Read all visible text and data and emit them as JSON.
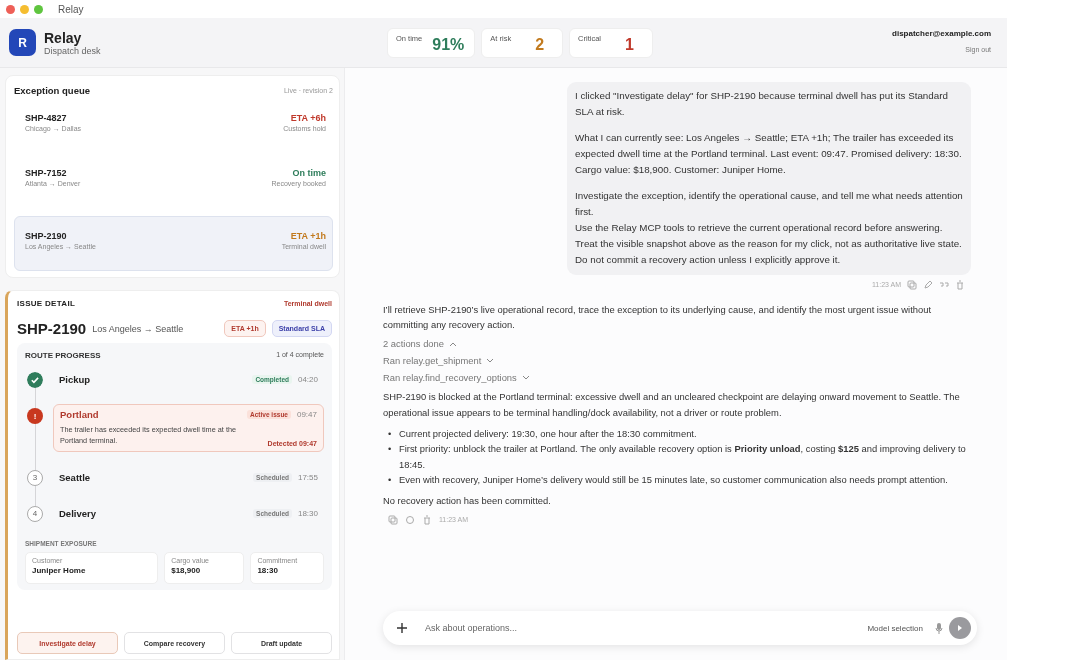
{
  "window": {
    "title": "Relay"
  },
  "app": {
    "logo": "R",
    "name": "Relay",
    "subtitle": "Dispatch desk"
  },
  "metrics": [
    {
      "label": "On time",
      "value": "91%",
      "color": "#2e7d5b"
    },
    {
      "label": "At risk",
      "value": "2",
      "color": "#c27a1e"
    },
    {
      "label": "Critical",
      "value": "1",
      "color": "#c0392b"
    }
  ],
  "account": {
    "email": "dispatcher@example.com",
    "sign_out": "Sign out"
  },
  "queue": {
    "title": "Exception queue",
    "status": "Live · revision 2",
    "items": [
      {
        "id": "SHP-4827",
        "route": "Chicago → Dallas",
        "eta": "ETA +6h",
        "note": "Customs hold",
        "color": "#c0392b",
        "selected": false
      },
      {
        "id": "SHP-7152",
        "route": "Atlanta → Denver",
        "eta": "On time",
        "note": "Recovery booked",
        "color": "#2e7d5b",
        "selected": false
      },
      {
        "id": "SHP-2190",
        "route": "Los Angeles → Seattle",
        "eta": "ETA +1h",
        "note": "Terminal dwell",
        "color": "#c27a1e",
        "selected": true
      }
    ]
  },
  "issue": {
    "heading": "ISSUE DETAIL",
    "tag": "Terminal dwell",
    "id": "SHP-2190",
    "route": "Los Angeles → Seattle",
    "badges": [
      {
        "label": "ETA +1h",
        "kind": "risk"
      },
      {
        "label": "Standard SLA",
        "kind": "sla"
      }
    ],
    "progress": {
      "title": "ROUTE PROGRESS",
      "summary": "1 of 4 complete",
      "stops": [
        {
          "kind": "done",
          "name": "Pickup",
          "status": "Completed",
          "time": "04:20"
        },
        {
          "kind": "issue",
          "marker": "!",
          "name": "Portland",
          "status": "Active issue",
          "time": "09:47",
          "detail": "The trailer has exceeded its expected dwell time at the Portland terminal.",
          "detected": "Detected 09:47"
        },
        {
          "kind": "pending",
          "marker": "3",
          "name": "Seattle",
          "status": "Scheduled",
          "time": "17:55"
        },
        {
          "kind": "pending",
          "marker": "4",
          "name": "Delivery",
          "status": "Scheduled",
          "time": "18:30"
        }
      ]
    },
    "exposure": {
      "title": "SHIPMENT EXPOSURE",
      "fields": [
        {
          "label": "Customer",
          "value": "Juniper Home"
        },
        {
          "label": "Cargo value",
          "value": "$18,900"
        },
        {
          "label": "Commitment",
          "value": "18:30"
        }
      ]
    },
    "actions": [
      {
        "label": "Investigate delay",
        "selected": true
      },
      {
        "label": "Compare recovery",
        "selected": false
      },
      {
        "label": "Draft update",
        "selected": false
      }
    ]
  },
  "chat": {
    "user": {
      "paragraphs": [
        "I clicked \"Investigate delay\" for SHP-2190 because terminal dwell has put its Standard SLA at risk.",
        "What I can currently see: Los Angeles → Seattle; ETA +1h; The trailer has exceeded its expected dwell time at the Portland terminal. Last event: 09:47. Promised delivery: 18:30. Cargo value: $18,900. Customer: Juniper Home.",
        "Investigate the exception, identify the operational cause, and tell me what needs attention first.\nUse the Relay MCP tools to retrieve the current operational record before answering. Treat the visible snapshot above as the reason for my click, not as authoritative live state. Do not commit a recovery action unless I explicitly approve it."
      ],
      "time": "11:23 AM"
    },
    "assistant": {
      "intro": "I’ll retrieve SHP-2190’s live operational record, trace the exception to its underlying cause, and identify the most urgent issue without committing any recovery action.",
      "actions_summary": "2 actions done",
      "actions_expanded": true,
      "actions": [
        "Ran relay.get_shipment",
        "Ran relay.find_recovery_options"
      ],
      "body": "SHP-2190 is blocked at the Portland terminal: excessive dwell and an uncleared checkpoint are delaying onward movement to Seattle. The operational issue appears to be terminal handling/dock availability, not a driver or route problem.",
      "bullets": [
        {
          "marker": "•",
          "text": "Current projected delivery: 19:30, one hour after the 18:30 commitment."
        },
        {
          "marker": "•",
          "text": "First priority: unblock the trailer at Portland. The only available recovery option is **Priority unload**, costing **$125** and improving delivery to 18:45."
        },
        {
          "marker": "•",
          "text": "Even with recovery, Juniper Home’s delivery would still be 15 minutes late, so customer communication also needs prompt attention."
        }
      ],
      "closing": "No recovery action has been committed.",
      "time": "11:23 AM"
    },
    "composer": {
      "placeholder": "Ask about operations...",
      "model": "Model selection"
    }
  }
}
